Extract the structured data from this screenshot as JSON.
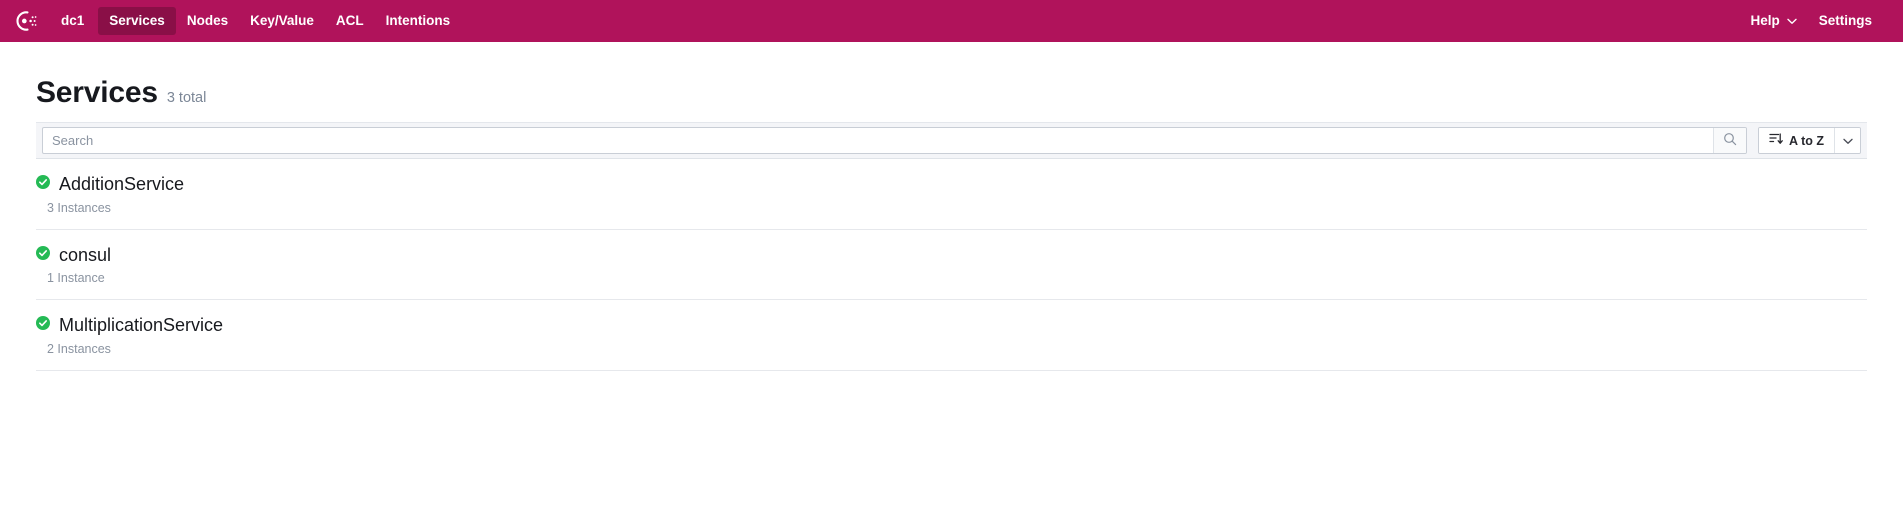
{
  "navbar": {
    "logo_icon": "consul-logo-icon",
    "datacenter": "dc1",
    "items": [
      {
        "label": "Services",
        "active": true
      },
      {
        "label": "Nodes",
        "active": false
      },
      {
        "label": "Key/Value",
        "active": false
      },
      {
        "label": "ACL",
        "active": false
      },
      {
        "label": "Intentions",
        "active": false
      }
    ],
    "help_label": "Help",
    "help_caret_icon": "chevron-down-icon",
    "settings_label": "Settings",
    "background_color": "#b0135b",
    "active_background_color": "#8a0f47"
  },
  "page": {
    "title": "Services",
    "count_label": "3 total"
  },
  "search": {
    "placeholder": "Search",
    "value": "",
    "search_icon": "search-icon",
    "sort_label": "A to Z",
    "sort_icon": "sort-descending-icon",
    "sort_caret_icon": "chevron-down-icon"
  },
  "services": [
    {
      "name": "AdditionService",
      "instances": "3 Instances",
      "status": "passing",
      "status_icon": "check-circle-icon",
      "status_color": "#25ba55"
    },
    {
      "name": "consul",
      "instances": "1 Instance",
      "status": "passing",
      "status_icon": "check-circle-icon",
      "status_color": "#25ba55"
    },
    {
      "name": "MultiplicationService",
      "instances": "2 Instances",
      "status": "passing",
      "status_icon": "check-circle-icon",
      "status_color": "#25ba55"
    }
  ]
}
